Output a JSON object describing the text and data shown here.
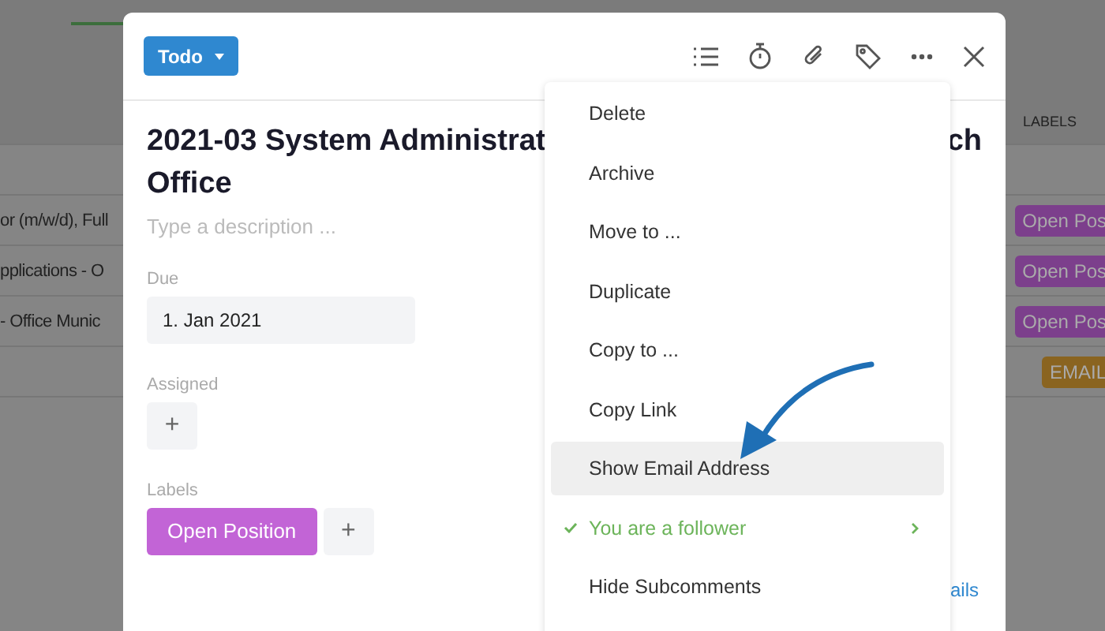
{
  "background": {
    "header_label": "LABELS",
    "rows": [
      {
        "text": "or (m/w/d), Full",
        "label": "Open Pos",
        "color": "#7c3f8c"
      },
      {
        "text": "pplications - O",
        "label": "Open Pos",
        "color": "#7c3f8c"
      },
      {
        "text": "- Office Munic",
        "label": "Open Pos",
        "color": "#7c3f8c"
      },
      {
        "text": "",
        "label": "EMAIL",
        "color": "#8a6420"
      }
    ]
  },
  "task": {
    "status": "Todo",
    "title_start": "2021-03 System Administrat",
    "title_end": "ch",
    "title_line2": "Office",
    "description_placeholder": "Type a description ...",
    "due": {
      "label": "Due",
      "value": "1. Jan 2021"
    },
    "assigned": {
      "label": "Assigned",
      "add": "+"
    },
    "labels": {
      "label": "Labels",
      "items": [
        {
          "text": "Open Position",
          "color": "#c264d6"
        }
      ],
      "add": "+"
    },
    "link": "ails"
  },
  "menu": {
    "items": [
      {
        "label": "Delete",
        "selected": false,
        "checked": false,
        "submenu": false
      },
      {
        "label": "Archive",
        "selected": false,
        "checked": false,
        "submenu": false
      },
      {
        "label": "Move to ...",
        "selected": false,
        "checked": false,
        "submenu": false
      },
      {
        "label": "Duplicate",
        "selected": false,
        "checked": false,
        "submenu": false
      },
      {
        "label": "Copy to ...",
        "selected": false,
        "checked": false,
        "submenu": false
      },
      {
        "label": "Copy Link",
        "selected": false,
        "checked": false,
        "submenu": false
      },
      {
        "label": "Show Email Address",
        "selected": true,
        "checked": false,
        "submenu": false
      },
      {
        "label": "You are a follower",
        "selected": false,
        "checked": true,
        "submenu": true
      },
      {
        "label": "Hide Subcomments",
        "selected": false,
        "checked": false,
        "submenu": false
      }
    ]
  }
}
